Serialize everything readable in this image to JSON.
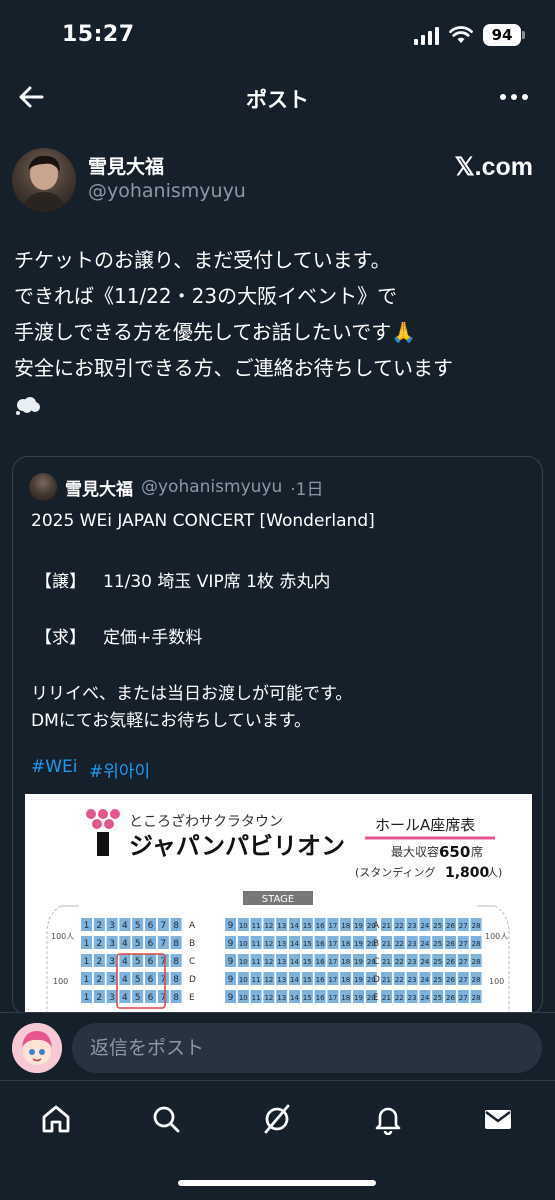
{
  "status": {
    "time": "15:27",
    "battery": "94"
  },
  "nav": {
    "title": "ポスト"
  },
  "author": {
    "name": "雪見大福",
    "handle": "@yohanismyuyu",
    "source": "𝕏.com"
  },
  "tweet": {
    "text": "チケットのお譲り、まだ受付しています。\nできれば《11/22・23の大阪イベント》で\n手渡しできる方を優先してお話したいです🙏\n安全にお取引できる方、ご連絡お待ちしています"
  },
  "quote": {
    "name": "雪見大福",
    "handle": "@yohanismyuyu",
    "time": "·1日",
    "title": "2025 WEi JAPAN CONCERT [Wonderland]",
    "give_label": "【譲】",
    "give_value": "11/30 埼玉 VIP席 1枚 赤丸内",
    "want_label": "【求】",
    "want_value": "定価+手数料",
    "note_line1": "リリイベ、または当日お渡しが可能です。",
    "note_line2": "DMにてお気軽にお待ちしています。",
    "hashtags": [
      "#WEi",
      "#위아이"
    ],
    "seatmap": {
      "subtitle": "ところざわサクラタウン",
      "venue": "ジャパンパビリオン",
      "hall": "ホールA座席表",
      "capacity_label": "最大収容",
      "capacity": "650",
      "capacity_unit": "席",
      "standing_label": "(スタンディング",
      "standing": "1,800",
      "standing_unit": "人)",
      "stage": "STAGE",
      "rows": [
        "A",
        "B",
        "C",
        "D",
        "E"
      ],
      "side_label": "100人",
      "side_num": "100"
    }
  },
  "reply": {
    "placeholder": "返信をポスト"
  },
  "colors": {
    "bg": "#15202b",
    "link": "#1d9bf0",
    "muted": "#8b98a5",
    "seat": "#7fb2dd",
    "highlight": "#d84a4a"
  },
  "tabs": [
    "home-icon",
    "search-icon",
    "grok-icon",
    "notifications-icon",
    "messages-icon"
  ]
}
